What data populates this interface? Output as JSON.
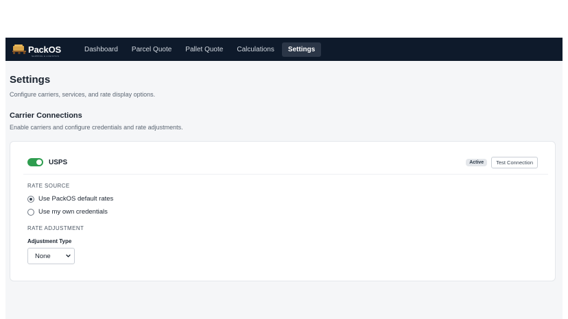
{
  "app": {
    "logo_text_pack": "Pack",
    "logo_text_os": "OS",
    "logo_tagline": "SHIPPING & LOGISTICS"
  },
  "nav": {
    "items": [
      {
        "label": "Dashboard",
        "active": false
      },
      {
        "label": "Parcel Quote",
        "active": false
      },
      {
        "label": "Pallet Quote",
        "active": false
      },
      {
        "label": "Calculations",
        "active": false
      },
      {
        "label": "Settings",
        "active": true
      }
    ]
  },
  "page": {
    "title": "Settings",
    "subtitle": "Configure carriers, services, and rate display options."
  },
  "section": {
    "title": "Carrier Connections",
    "subtitle": "Enable carriers and configure credentials and rate adjustments."
  },
  "carrier": {
    "name": "USPS",
    "enabled": true,
    "status_badge": "Active",
    "test_button": "Test Connection",
    "rate_source_label": "RATE SOURCE",
    "rate_source_options": [
      {
        "label": "Use PackOS default rates",
        "checked": true
      },
      {
        "label": "Use my own credentials",
        "checked": false
      }
    ],
    "rate_adjustment_label": "RATE ADJUSTMENT",
    "adjustment_type_label": "Adjustment Type",
    "adjustment_type_value": "None"
  },
  "colors": {
    "navbar": "#0e1a2b",
    "toggle_on": "#2e9d4f",
    "page_bg": "#f5f6f8"
  }
}
